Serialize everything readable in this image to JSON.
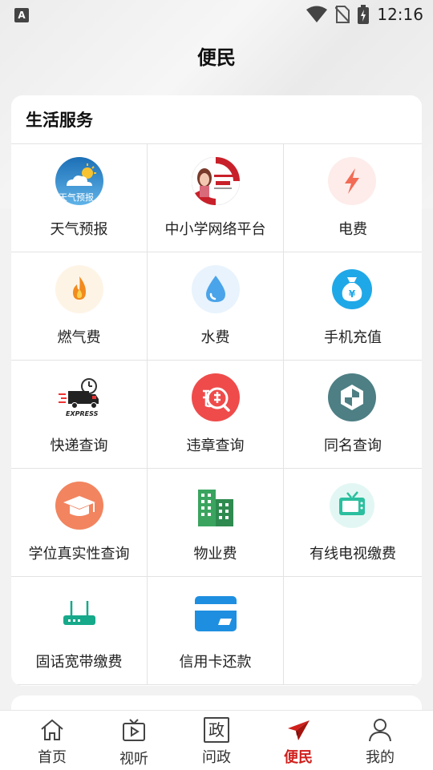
{
  "status_bar": {
    "time": "12:16",
    "notif": "A"
  },
  "header": {
    "title": "便民"
  },
  "section": {
    "title": "生活服务",
    "items": [
      {
        "label": "天气预报",
        "icon": "weather-icon",
        "sub": "天气预报"
      },
      {
        "label": "中小学网络平台",
        "icon": "school-platform-icon"
      },
      {
        "label": "电费",
        "icon": "lightning-icon"
      },
      {
        "label": "燃气费",
        "icon": "flame-icon"
      },
      {
        "label": "水费",
        "icon": "water-drop-icon"
      },
      {
        "label": "手机充值",
        "icon": "money-bag-icon"
      },
      {
        "label": "快递查询",
        "icon": "express-truck-icon",
        "sub": "EXPRESS"
      },
      {
        "label": "违章查询",
        "icon": "violation-icon"
      },
      {
        "label": "同名查询",
        "icon": "shield-icon"
      },
      {
        "label": "学位真实性查询",
        "icon": "graduation-cap-icon"
      },
      {
        "label": "物业费",
        "icon": "buildings-icon"
      },
      {
        "label": "有线电视缴费",
        "icon": "tv-icon"
      },
      {
        "label": "固话宽带缴费",
        "icon": "router-icon"
      },
      {
        "label": "信用卡还款",
        "icon": "credit-card-icon"
      }
    ]
  },
  "tabbar": {
    "tabs": [
      {
        "label": "首页",
        "icon": "home-icon"
      },
      {
        "label": "视听",
        "icon": "video-icon"
      },
      {
        "label": "问政",
        "icon": "politics-icon",
        "glyph": "政"
      },
      {
        "label": "便民",
        "icon": "plane-icon",
        "active": true
      },
      {
        "label": "我的",
        "icon": "user-icon"
      }
    ]
  },
  "colors": {
    "accent": "#d0201c"
  }
}
